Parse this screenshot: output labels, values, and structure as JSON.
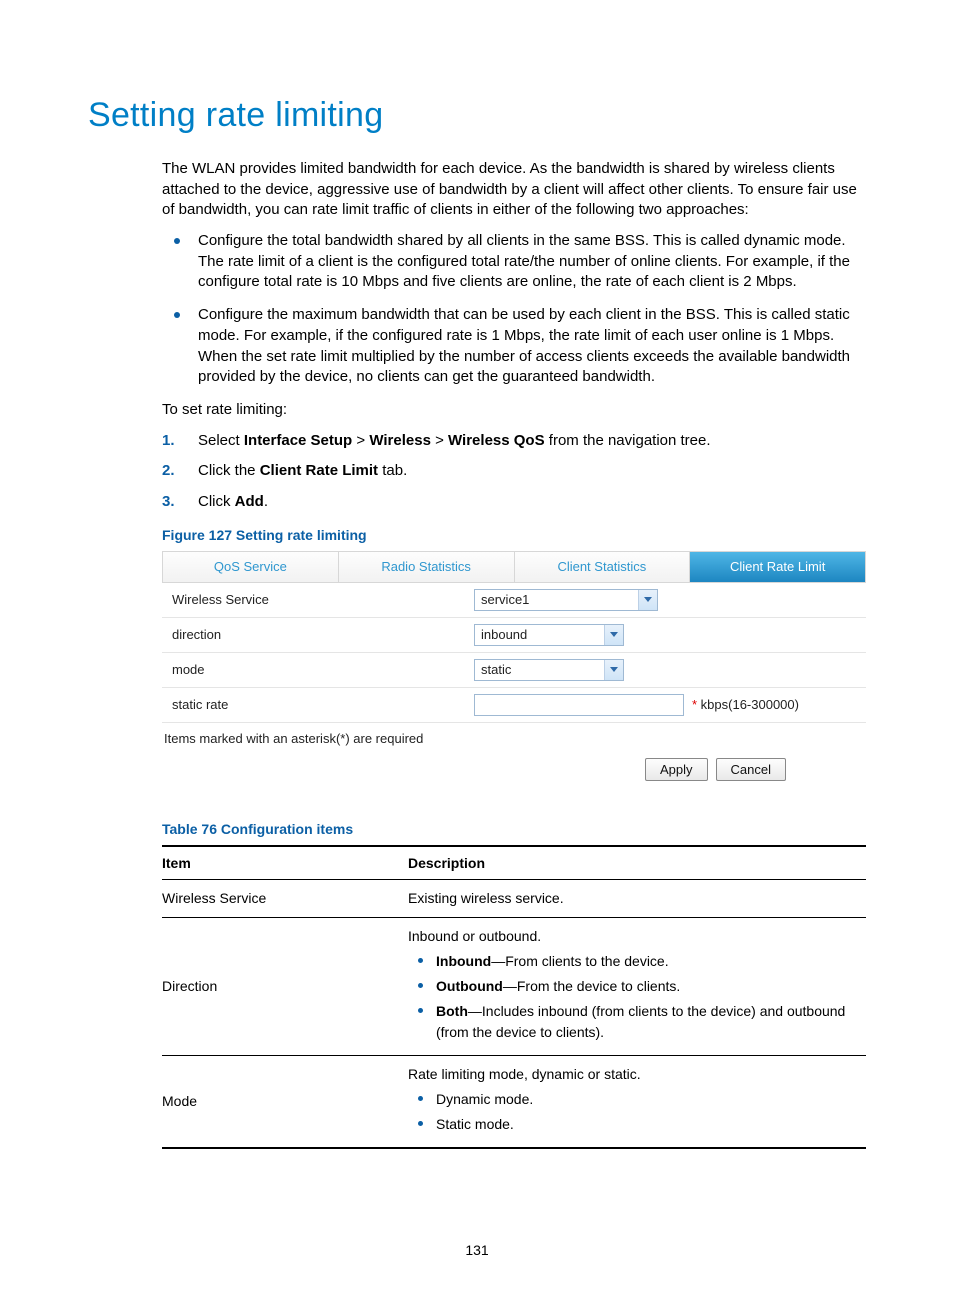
{
  "title": "Setting rate limiting",
  "intro": "The WLAN provides limited bandwidth for each device. As the bandwidth is shared by wireless clients attached to the device, aggressive use of bandwidth by a client will affect other clients. To ensure fair use of bandwidth, you can rate limit traffic of clients in either of the following two approaches:",
  "bullets": [
    "Configure the total bandwidth shared by all clients in the same BSS. This is called dynamic mode. The rate limit of a client is the configured total rate/the number of online clients. For example, if the configure total rate is 10 Mbps and five clients are online, the rate of each client is 2 Mbps.",
    "Configure the maximum bandwidth that can be used by each client in the BSS. This is called static mode. For example, if the configured rate is 1 Mbps, the rate limit of each user online is 1 Mbps. When the set rate limit multiplied by the number of access clients exceeds the available bandwidth provided by the device, no clients can get the guaranteed bandwidth."
  ],
  "to_set": "To set rate limiting:",
  "steps": {
    "s1_pre": "Select ",
    "s1_b1": "Interface Setup",
    "s1_sep": " > ",
    "s1_b2": "Wireless",
    "s1_b3": "Wireless QoS",
    "s1_post": " from the navigation tree.",
    "s2_pre": "Click the ",
    "s2_b": "Client Rate Limit",
    "s2_post": " tab.",
    "s3_pre": "Click ",
    "s3_b": "Add",
    "s3_post": "."
  },
  "figure_caption": "Figure 127 Setting rate limiting",
  "figure": {
    "tabs": [
      "QoS Service",
      "Radio Statistics",
      "Client Statistics",
      "Client Rate Limit"
    ],
    "active_tab": 3,
    "rows": {
      "wireless_label": "Wireless Service",
      "wireless_value": "service1",
      "direction_label": "direction",
      "direction_value": "inbound",
      "mode_label": "mode",
      "mode_value": "static",
      "rate_label": "static rate",
      "rate_hint_star": "*",
      "rate_hint": " kbps(16-300000)"
    },
    "footnote": "Items marked with an asterisk(*) are required",
    "apply": "Apply",
    "cancel": "Cancel"
  },
  "table_caption": "Table 76 Configuration items",
  "table": {
    "head_item": "Item",
    "head_desc": "Description",
    "r1_item": "Wireless Service",
    "r1_desc": "Existing wireless service.",
    "r2_item": "Direction",
    "r2_desc_lead": "Inbound or outbound.",
    "r2_li1_b": "Inbound",
    "r2_li1_t": "—From clients to the device.",
    "r2_li2_b": "Outbound",
    "r2_li2_t": "—From the device to clients.",
    "r2_li3_b": "Both",
    "r2_li3_t": "—Includes inbound (from clients to the device) and outbound (from the device to clients).",
    "r3_item": "Mode",
    "r3_desc_lead": "Rate limiting mode, dynamic or static.",
    "r3_li1": "Dynamic mode.",
    "r3_li2": "Static mode."
  },
  "page_number": "131"
}
